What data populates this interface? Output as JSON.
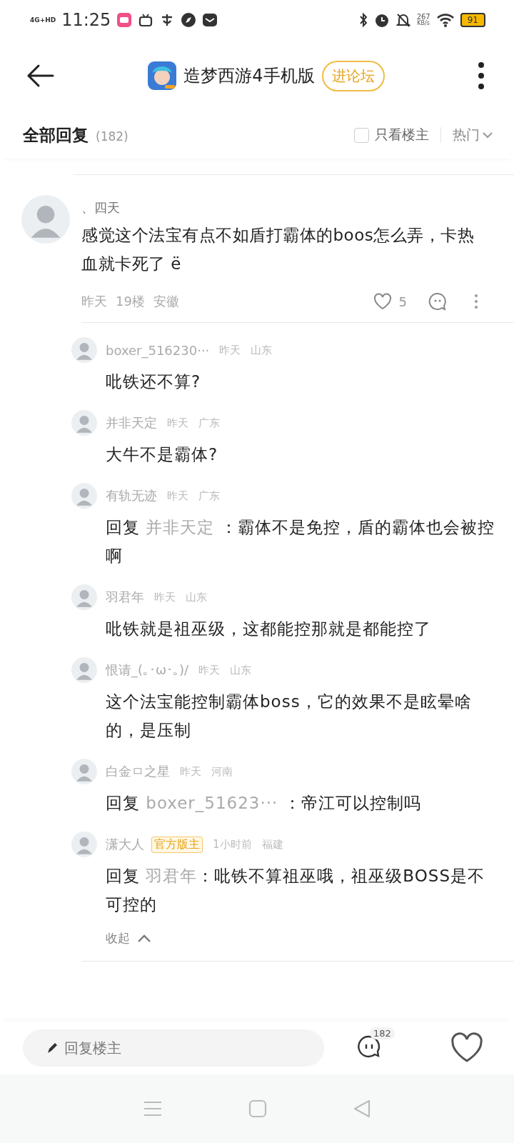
{
  "status_bar": {
    "network": "4G+HD",
    "time": "11:25",
    "speed": "267",
    "speed_unit": "KB/s",
    "battery": "91"
  },
  "header": {
    "title": "造梦西游4手机版",
    "forum_button": "进论坛"
  },
  "replies_header": {
    "title": "全部回复",
    "count": "(182)",
    "owner_only": {
      "label": "只看楼主",
      "checked": false
    },
    "sort": "热门"
  },
  "post": {
    "author": "、四天",
    "text": "感觉这个法宝有点不如盾打霸体的boos怎么弄，卡热血就卡死了 ë",
    "time": "昨天",
    "floor": "19楼",
    "location": "安徽",
    "likes": "5"
  },
  "replies": [
    {
      "author": "boxer_516230···",
      "time": "昨天",
      "location": "山东",
      "text": "吡铁还不算?"
    },
    {
      "author": "并非天定",
      "time": "昨天",
      "location": "广东",
      "text": "大牛不是霸体?"
    },
    {
      "author": "有轨无迹",
      "time": "昨天",
      "location": "广东",
      "reply_label": "回复",
      "reply_to": "并非天定",
      "text": " ：霸体不是免控，盾的霸体也会被控啊"
    },
    {
      "author": "羽君年",
      "time": "昨天",
      "location": "山东",
      "text": "吡铁就是祖巫级，这都能控那就是都能控了"
    },
    {
      "author": "恨请_(｡･ω･｡)/",
      "time": "昨天",
      "location": "山东",
      "text": "这个法宝能控制霸体boss，它的效果不是眩晕啥的，是压制"
    },
    {
      "author": "白金ㅁ之星",
      "time": "昨天",
      "location": "河南",
      "reply_label": "回复",
      "reply_to": "boxer_51623···",
      "text": " ：帝江可以控制吗"
    },
    {
      "author": "潇大人",
      "badge": "官方版主",
      "time": "1小时前",
      "location": "福建",
      "reply_label": "回复",
      "reply_to": "羽君年",
      "text": "：吡铁不算祖巫哦，祖巫级BOSS是不可控的"
    }
  ],
  "collapse": "收起",
  "bottom_bar": {
    "placeholder": "回复楼主",
    "comment_count": "182"
  }
}
